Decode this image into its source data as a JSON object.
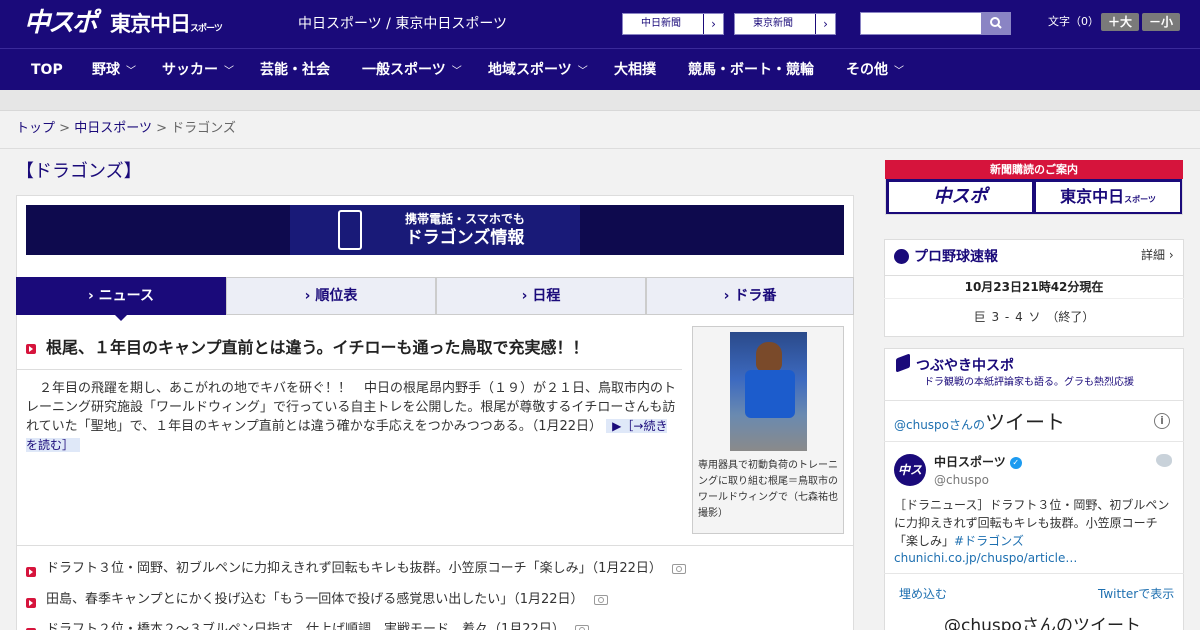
{
  "header": {
    "logo_chuspo": "中スポ",
    "logo_tokyo": "東京中日",
    "logo_tokyo_small": "スポーツ",
    "site_title": "中日スポーツ / 東京中日スポーツ",
    "links": [
      {
        "label": "中日新聞",
        "arrow": "›"
      },
      {
        "label": "東京新聞",
        "arrow": "›"
      }
    ],
    "search_placeholder": "",
    "font_label": "文字（0）",
    "font_larger": "＋大",
    "font_smaller": "－小"
  },
  "nav": [
    {
      "label": "TOP",
      "chevron": ""
    },
    {
      "label": "野球",
      "chevron": "﹀"
    },
    {
      "label": "サッカー",
      "chevron": "﹀"
    },
    {
      "label": "芸能・社会",
      "chevron": ""
    },
    {
      "label": "一般スポーツ",
      "chevron": "﹀"
    },
    {
      "label": "地域スポーツ",
      "chevron": "﹀"
    },
    {
      "label": "大相撲",
      "chevron": ""
    },
    {
      "label": "競馬・ボート・競輪",
      "chevron": ""
    },
    {
      "label": "その他",
      "chevron": "﹀"
    }
  ],
  "breadcrumb": {
    "items": [
      "トップ",
      "中日スポーツ",
      "ドラゴンズ"
    ],
    "separator": ">"
  },
  "page_title": "【ドラゴンズ】",
  "banner": {
    "line1": "携帯電話・スマホでも",
    "line2": "ドラゴンズ情報"
  },
  "tabs": [
    {
      "label": "› ニュース"
    },
    {
      "label": "› 順位表"
    },
    {
      "label": "› 日程"
    },
    {
      "label": "› ドラ番"
    }
  ],
  "article": {
    "headline": "根尾、１年目のキャンプ直前とは違う。イチローも通った鳥取で充実感！！",
    "body": "２年目の飛躍を期し、あこがれの地でキバを研ぐ！！　中日の根尾昂内野手（１９）が２１日、鳥取市内のトレーニング研究施設「ワールドウィング」で行っている自主トレを公開した。根尾が尊敬するイチローさんも訪れていた「聖地」で、１年目のキャンプ直前とは違う確かな手応えをつかみつつある。（1月22日）",
    "read_more": "▶［→続きを読む］",
    "caption": "専用器具で初動負荷のトレーニングに取り組む根尾＝鳥取市のワールドウィングで（七森祐也撮影）"
  },
  "news_list": [
    {
      "text": "ドラフト３位・岡野、初ブルペンに力抑えきれず回転もキレも抜群。小笠原コーチ「楽しみ」（1月22日）"
    },
    {
      "text": "田島、春季キャンプとにかく投げ込む「もう一回体で投げる感覚思い出したい」（1月22日）"
    },
    {
      "text": "ドラフト２位・橋本２～３ブルペン日指す　仕上げ順調　実戦モード…着々（1月22日）"
    }
  ],
  "sidebar": {
    "subscribe": {
      "title": "新聞購読のご案内",
      "btn1": "中スポ",
      "btn2": "東京中日",
      "btn2_small": "スポーツ"
    },
    "score": {
      "title": "プロ野球速報",
      "more": "詳細 ›",
      "time": "10月23日21時42分現在",
      "line": "巨 3 - 4 ソ （終了）"
    },
    "tweets": {
      "title": "つぶやき中スポ",
      "subtitle": "ドラ観戦の本紙評論家も語る。グラも熱烈応援",
      "header_handle": "@chuspoさんの",
      "header_big": "ツイート",
      "info": "i",
      "avatar_text": "中スポ",
      "name": "中日スポーツ",
      "verified": "✓",
      "handle": "@chuspo",
      "text": "［ドラニュース］ドラフト３位・岡野、初ブルペンに力抑えきれず回転もキレも抜群。小笠原コーチ「楽しみ」",
      "hashtag": "#ドラゴンズ",
      "link": "chunichi.co.jp/chuspo/article…",
      "embed": "埋め込む",
      "view_on_twitter": "Twitterで表示",
      "footer": "@chuspoさんのツイート"
    }
  },
  "colors": {
    "brand": "#1a0a7a",
    "accent": "#d6143c",
    "link": "#1d6fb0"
  }
}
